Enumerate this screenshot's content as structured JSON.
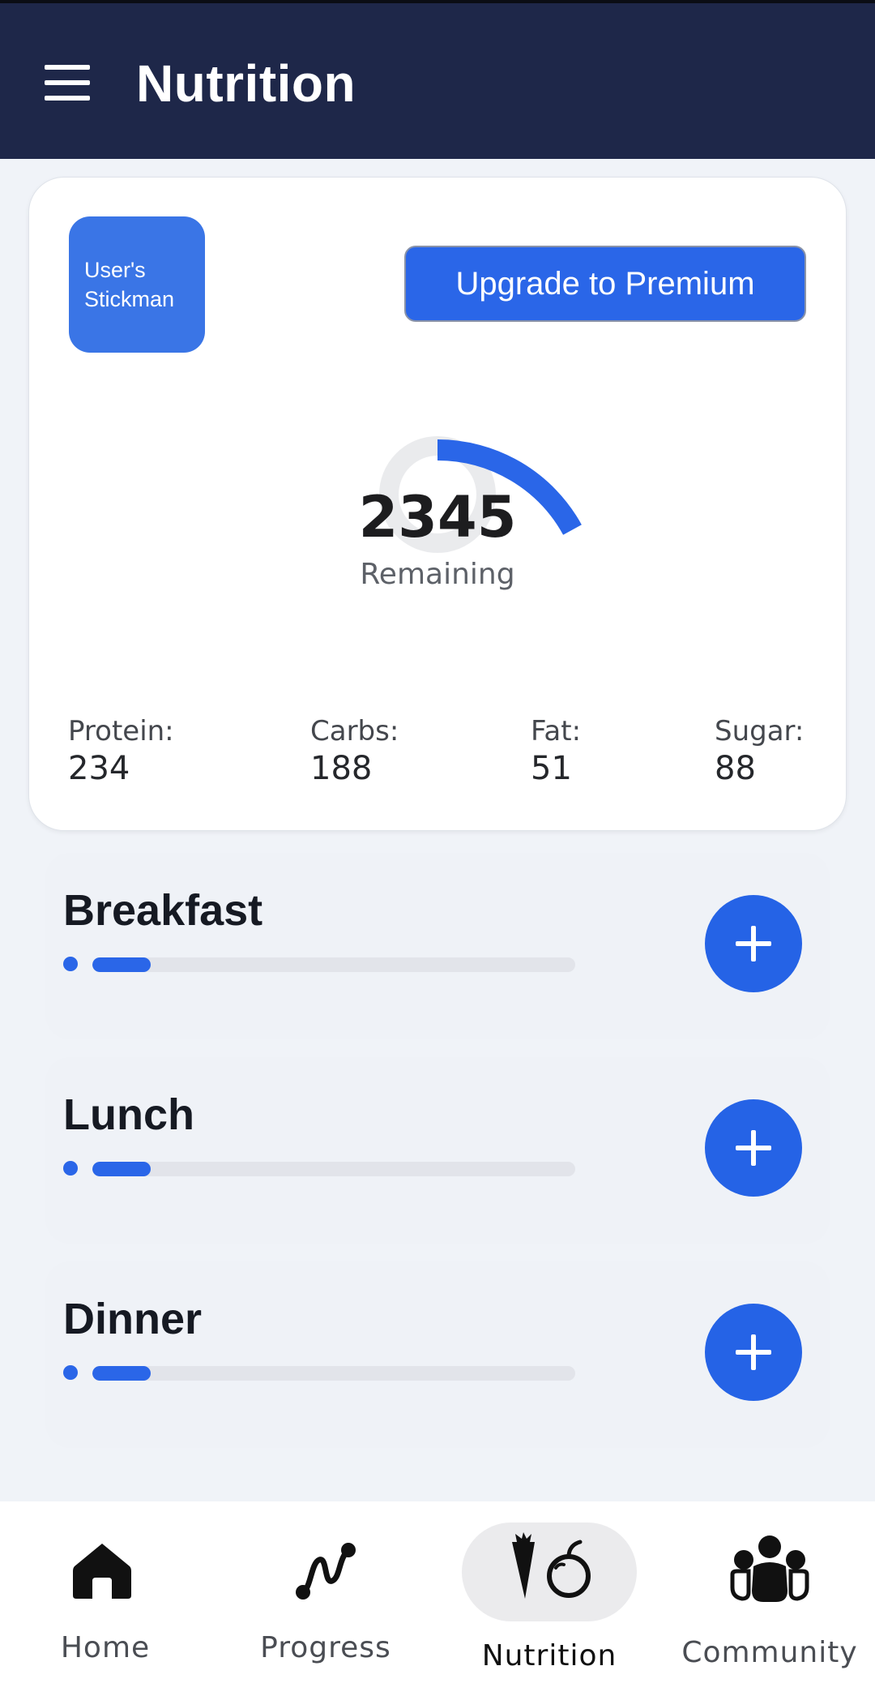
{
  "header": {
    "title": "Nutrition",
    "menu_icon": "hamburger-menu-icon"
  },
  "summary": {
    "avatar_text": "User's Stickman",
    "upgrade_label": "Upgrade to Premium",
    "remaining_value": "2345",
    "remaining_label": "Remaining",
    "gauge_fraction": 0.17,
    "macros": [
      {
        "label": "Protein:",
        "value": "234"
      },
      {
        "label": "Carbs:",
        "value": "188"
      },
      {
        "label": "Fat:",
        "value": "51"
      },
      {
        "label": "Sugar:",
        "value": "88"
      }
    ]
  },
  "meals": [
    {
      "name": "Breakfast",
      "progress": 0.12,
      "add_icon": "plus-icon"
    },
    {
      "name": "Lunch",
      "progress": 0.12,
      "add_icon": "plus-icon"
    },
    {
      "name": "Dinner",
      "progress": 0.12,
      "add_icon": "plus-icon"
    }
  ],
  "nav": {
    "active": "Nutrition",
    "items": [
      {
        "label": "Home",
        "icon": "home-icon"
      },
      {
        "label": "Progress",
        "icon": "progress-icon"
      },
      {
        "label": "Nutrition",
        "icon": "nutrition-icon"
      },
      {
        "label": "Community",
        "icon": "community-icon"
      }
    ]
  },
  "colors": {
    "header_bg": "#1e2749",
    "accent": "#2a66e8",
    "page_bg": "#f0f3f8"
  }
}
